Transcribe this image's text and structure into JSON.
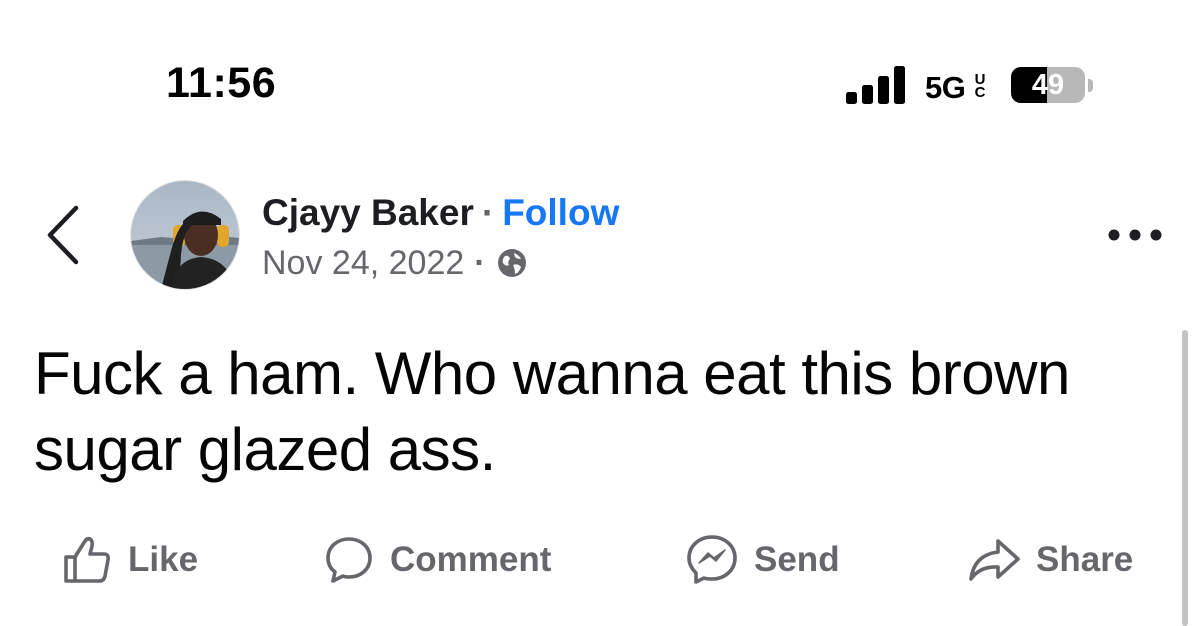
{
  "status_bar": {
    "time": "11:56",
    "network": "5G",
    "network_badge": "UC",
    "battery_level": "49",
    "battery_percent": 49
  },
  "post": {
    "author": "Cjayy Baker",
    "separator": "·",
    "follow_label": "Follow",
    "date": "Nov 24, 2022",
    "privacy_icon": "globe-icon",
    "text": "Fuck a ham. Who wanna eat this brown sugar glazed ass."
  },
  "actions": {
    "like_label": "Like",
    "comment_label": "Comment",
    "send_label": "Send",
    "share_label": "Share"
  },
  "colors": {
    "link": "#1877f2",
    "secondary_text": "#65676b",
    "primary_text": "#050505",
    "background": "#ffffff"
  }
}
